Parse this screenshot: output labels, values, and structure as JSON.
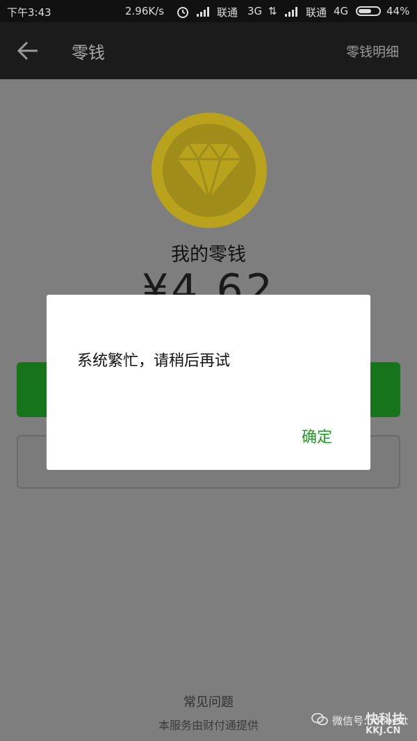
{
  "status_bar": {
    "time": "下午3:43",
    "speed": "2.96K/s",
    "carrier1": "联通",
    "network1": "3G",
    "carrier2": "联通",
    "network2": "4G",
    "battery": "44%"
  },
  "header": {
    "title": "零钱",
    "detail_link": "零钱明细"
  },
  "main": {
    "heading": "我的零钱",
    "amount": "¥4.62",
    "faq": "常见问题",
    "service_note": "本服务由财付通提供"
  },
  "dialog": {
    "message": "系统繁忙，请稍后再试",
    "confirm": "确定"
  },
  "watermark": {
    "wechat_id": "微信号: idcbest",
    "brand": "快科技",
    "domain": "KKJ.CN"
  },
  "colors": {
    "accent": "#1f9a26",
    "primary_button": "#16741b",
    "coin": "#b9a21c",
    "titlebar": "#1b1b1b"
  }
}
